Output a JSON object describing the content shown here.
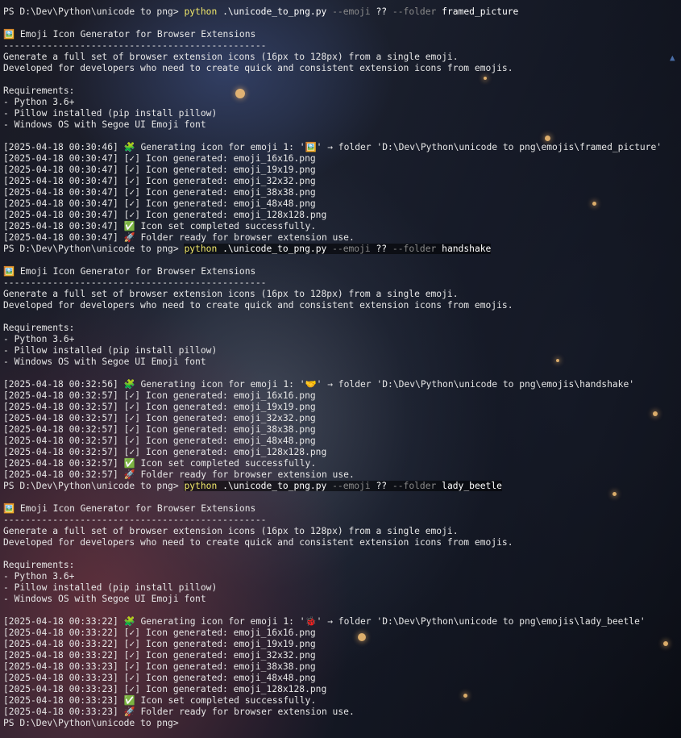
{
  "prompt": "PS D:\\Dev\\Python\\unicode to png> ",
  "runs": [
    {
      "command": {
        "exe": "python",
        "script": " .\\unicode_to_png.py ",
        "flag_emoji": "--emoji",
        "emoji_arg": " ?? ",
        "flag_folder": "--folder",
        "folder_arg": " framed_picture"
      },
      "header": "🖼️ Emoji Icon Generator for Browser Extensions",
      "rule": "------------------------------------------------",
      "desc1": "Generate a full set of browser extension icons (16px to 128px) from a single emoji.",
      "desc2": "Developed for developers who need to create quick and consistent extension icons from emojis.",
      "req_title": "Requirements:",
      "req1": "- Python 3.6+",
      "req2": "- Pillow installed (pip install pillow)",
      "req3": "- Windows OS with Segoe UI Emoji font",
      "log": [
        "[2025-04-18 00:30:46] 🧩 Generating icon for emoji 1: '🖼️' → folder 'D:\\Dev\\Python\\unicode to png\\emojis\\framed_picture'",
        "[2025-04-18 00:30:47] [✓] Icon generated: emoji_16x16.png",
        "[2025-04-18 00:30:47] [✓] Icon generated: emoji_19x19.png",
        "[2025-04-18 00:30:47] [✓] Icon generated: emoji_32x32.png",
        "[2025-04-18 00:30:47] [✓] Icon generated: emoji_38x38.png",
        "[2025-04-18 00:30:47] [✓] Icon generated: emoji_48x48.png",
        "[2025-04-18 00:30:47] [✓] Icon generated: emoji_128x128.png",
        "[2025-04-18 00:30:47] ✅ Icon set completed successfully.",
        "[2025-04-18 00:30:47] 🚀 Folder ready for browser extension use."
      ]
    },
    {
      "command": {
        "exe": "python",
        "script": " .\\unicode_to_png.py ",
        "flag_emoji": "--emoji",
        "emoji_arg": " ?? ",
        "flag_folder": "--folder",
        "folder_arg": " handshake"
      },
      "header": "🖼️ Emoji Icon Generator for Browser Extensions",
      "rule": "------------------------------------------------",
      "desc1": "Generate a full set of browser extension icons (16px to 128px) from a single emoji.",
      "desc2": "Developed for developers who need to create quick and consistent extension icons from emojis.",
      "req_title": "Requirements:",
      "req1": "- Python 3.6+",
      "req2": "- Pillow installed (pip install pillow)",
      "req3": "- Windows OS with Segoe UI Emoji font",
      "log": [
        "[2025-04-18 00:32:56] 🧩 Generating icon for emoji 1: '🤝' → folder 'D:\\Dev\\Python\\unicode to png\\emojis\\handshake'",
        "[2025-04-18 00:32:57] [✓] Icon generated: emoji_16x16.png",
        "[2025-04-18 00:32:57] [✓] Icon generated: emoji_19x19.png",
        "[2025-04-18 00:32:57] [✓] Icon generated: emoji_32x32.png",
        "[2025-04-18 00:32:57] [✓] Icon generated: emoji_38x38.png",
        "[2025-04-18 00:32:57] [✓] Icon generated: emoji_48x48.png",
        "[2025-04-18 00:32:57] [✓] Icon generated: emoji_128x128.png",
        "[2025-04-18 00:32:57] ✅ Icon set completed successfully.",
        "[2025-04-18 00:32:57] 🚀 Folder ready for browser extension use."
      ]
    },
    {
      "command": {
        "exe": "python",
        "script": " .\\unicode_to_png.py ",
        "flag_emoji": "--emoji",
        "emoji_arg": " ?? ",
        "flag_folder": "--folder",
        "folder_arg": " lady_beetle"
      },
      "header": "🖼️ Emoji Icon Generator for Browser Extensions",
      "rule": "------------------------------------------------",
      "desc1": "Generate a full set of browser extension icons (16px to 128px) from a single emoji.",
      "desc2": "Developed for developers who need to create quick and consistent extension icons from emojis.",
      "req_title": "Requirements:",
      "req1": "- Python 3.6+",
      "req2": "- Pillow installed (pip install pillow)",
      "req3": "- Windows OS with Segoe UI Emoji font",
      "log": [
        "[2025-04-18 00:33:22] 🧩 Generating icon for emoji 1: '🐞' → folder 'D:\\Dev\\Python\\unicode to png\\emojis\\lady_beetle'",
        "[2025-04-18 00:33:22] [✓] Icon generated: emoji_16x16.png",
        "[2025-04-18 00:33:22] [✓] Icon generated: emoji_19x19.png",
        "[2025-04-18 00:33:22] [✓] Icon generated: emoji_32x32.png",
        "[2025-04-18 00:33:23] [✓] Icon generated: emoji_38x38.png",
        "[2025-04-18 00:33:23] [✓] Icon generated: emoji_48x48.png",
        "[2025-04-18 00:33:23] [✓] Icon generated: emoji_128x128.png",
        "[2025-04-18 00:33:23] ✅ Icon set completed successfully.",
        "[2025-04-18 00:33:23] 🚀 Folder ready for browser extension use."
      ]
    }
  ],
  "final_prompt": "PS D:\\Dev\\Python\\unicode to png> ",
  "colors": {
    "command": "#f2e96b",
    "flag": "#8a8a8a",
    "text": "#e6e6e6",
    "background": "#0b0d14"
  }
}
